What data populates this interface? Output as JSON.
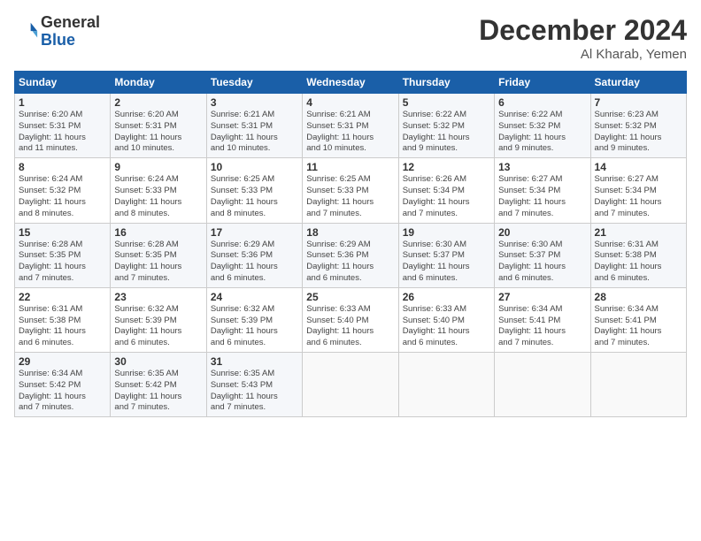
{
  "header": {
    "logo_line1": "General",
    "logo_line2": "Blue",
    "month": "December 2024",
    "location": "Al Kharab, Yemen"
  },
  "weekdays": [
    "Sunday",
    "Monday",
    "Tuesday",
    "Wednesday",
    "Thursday",
    "Friday",
    "Saturday"
  ],
  "weeks": [
    [
      {
        "day": "1",
        "info": "Sunrise: 6:20 AM\nSunset: 5:31 PM\nDaylight: 11 hours\nand 11 minutes."
      },
      {
        "day": "2",
        "info": "Sunrise: 6:20 AM\nSunset: 5:31 PM\nDaylight: 11 hours\nand 10 minutes."
      },
      {
        "day": "3",
        "info": "Sunrise: 6:21 AM\nSunset: 5:31 PM\nDaylight: 11 hours\nand 10 minutes."
      },
      {
        "day": "4",
        "info": "Sunrise: 6:21 AM\nSunset: 5:31 PM\nDaylight: 11 hours\nand 10 minutes."
      },
      {
        "day": "5",
        "info": "Sunrise: 6:22 AM\nSunset: 5:32 PM\nDaylight: 11 hours\nand 9 minutes."
      },
      {
        "day": "6",
        "info": "Sunrise: 6:22 AM\nSunset: 5:32 PM\nDaylight: 11 hours\nand 9 minutes."
      },
      {
        "day": "7",
        "info": "Sunrise: 6:23 AM\nSunset: 5:32 PM\nDaylight: 11 hours\nand 9 minutes."
      }
    ],
    [
      {
        "day": "8",
        "info": "Sunrise: 6:24 AM\nSunset: 5:32 PM\nDaylight: 11 hours\nand 8 minutes."
      },
      {
        "day": "9",
        "info": "Sunrise: 6:24 AM\nSunset: 5:33 PM\nDaylight: 11 hours\nand 8 minutes."
      },
      {
        "day": "10",
        "info": "Sunrise: 6:25 AM\nSunset: 5:33 PM\nDaylight: 11 hours\nand 8 minutes."
      },
      {
        "day": "11",
        "info": "Sunrise: 6:25 AM\nSunset: 5:33 PM\nDaylight: 11 hours\nand 7 minutes."
      },
      {
        "day": "12",
        "info": "Sunrise: 6:26 AM\nSunset: 5:34 PM\nDaylight: 11 hours\nand 7 minutes."
      },
      {
        "day": "13",
        "info": "Sunrise: 6:27 AM\nSunset: 5:34 PM\nDaylight: 11 hours\nand 7 minutes."
      },
      {
        "day": "14",
        "info": "Sunrise: 6:27 AM\nSunset: 5:34 PM\nDaylight: 11 hours\nand 7 minutes."
      }
    ],
    [
      {
        "day": "15",
        "info": "Sunrise: 6:28 AM\nSunset: 5:35 PM\nDaylight: 11 hours\nand 7 minutes."
      },
      {
        "day": "16",
        "info": "Sunrise: 6:28 AM\nSunset: 5:35 PM\nDaylight: 11 hours\nand 7 minutes."
      },
      {
        "day": "17",
        "info": "Sunrise: 6:29 AM\nSunset: 5:36 PM\nDaylight: 11 hours\nand 6 minutes."
      },
      {
        "day": "18",
        "info": "Sunrise: 6:29 AM\nSunset: 5:36 PM\nDaylight: 11 hours\nand 6 minutes."
      },
      {
        "day": "19",
        "info": "Sunrise: 6:30 AM\nSunset: 5:37 PM\nDaylight: 11 hours\nand 6 minutes."
      },
      {
        "day": "20",
        "info": "Sunrise: 6:30 AM\nSunset: 5:37 PM\nDaylight: 11 hours\nand 6 minutes."
      },
      {
        "day": "21",
        "info": "Sunrise: 6:31 AM\nSunset: 5:38 PM\nDaylight: 11 hours\nand 6 minutes."
      }
    ],
    [
      {
        "day": "22",
        "info": "Sunrise: 6:31 AM\nSunset: 5:38 PM\nDaylight: 11 hours\nand 6 minutes."
      },
      {
        "day": "23",
        "info": "Sunrise: 6:32 AM\nSunset: 5:39 PM\nDaylight: 11 hours\nand 6 minutes."
      },
      {
        "day": "24",
        "info": "Sunrise: 6:32 AM\nSunset: 5:39 PM\nDaylight: 11 hours\nand 6 minutes."
      },
      {
        "day": "25",
        "info": "Sunrise: 6:33 AM\nSunset: 5:40 PM\nDaylight: 11 hours\nand 6 minutes."
      },
      {
        "day": "26",
        "info": "Sunrise: 6:33 AM\nSunset: 5:40 PM\nDaylight: 11 hours\nand 6 minutes."
      },
      {
        "day": "27",
        "info": "Sunrise: 6:34 AM\nSunset: 5:41 PM\nDaylight: 11 hours\nand 7 minutes."
      },
      {
        "day": "28",
        "info": "Sunrise: 6:34 AM\nSunset: 5:41 PM\nDaylight: 11 hours\nand 7 minutes."
      }
    ],
    [
      {
        "day": "29",
        "info": "Sunrise: 6:34 AM\nSunset: 5:42 PM\nDaylight: 11 hours\nand 7 minutes."
      },
      {
        "day": "30",
        "info": "Sunrise: 6:35 AM\nSunset: 5:42 PM\nDaylight: 11 hours\nand 7 minutes."
      },
      {
        "day": "31",
        "info": "Sunrise: 6:35 AM\nSunset: 5:43 PM\nDaylight: 11 hours\nand 7 minutes."
      },
      null,
      null,
      null,
      null
    ]
  ]
}
